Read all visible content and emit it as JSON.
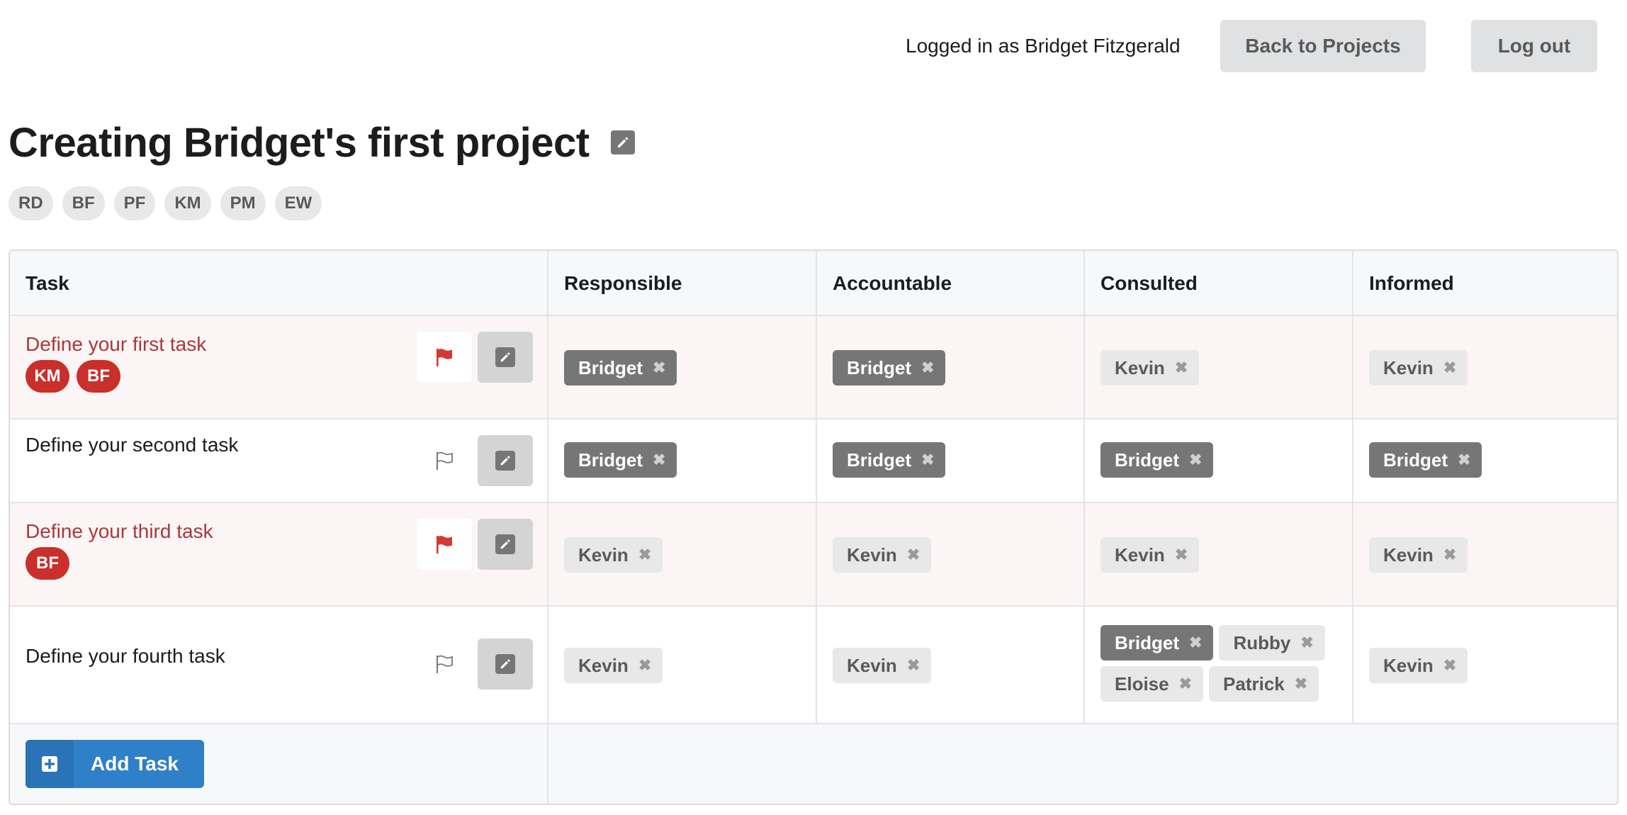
{
  "header": {
    "logged_in_text": "Logged in as Bridget Fitzgerald",
    "back_label": "Back to Projects",
    "logout_label": "Log out"
  },
  "project": {
    "title": "Creating Bridget's first project",
    "members": [
      "RD",
      "BF",
      "PF",
      "KM",
      "PM",
      "EW"
    ]
  },
  "table": {
    "columns": [
      "Task",
      "Responsible",
      "Accountable",
      "Consulted",
      "Informed"
    ],
    "rows": [
      {
        "task": "Define your first task",
        "flagged": true,
        "owners": [
          "KM",
          "BF"
        ],
        "responsible": [
          {
            "name": "Bridget",
            "style": "dark"
          }
        ],
        "accountable": [
          {
            "name": "Bridget",
            "style": "dark"
          }
        ],
        "consulted": [
          {
            "name": "Kevin",
            "style": "light"
          }
        ],
        "informed": [
          {
            "name": "Kevin",
            "style": "light"
          }
        ]
      },
      {
        "task": "Define your second task",
        "flagged": false,
        "owners": [],
        "responsible": [
          {
            "name": "Bridget",
            "style": "dark"
          }
        ],
        "accountable": [
          {
            "name": "Bridget",
            "style": "dark"
          }
        ],
        "consulted": [
          {
            "name": "Bridget",
            "style": "dark"
          }
        ],
        "informed": [
          {
            "name": "Bridget",
            "style": "dark"
          }
        ]
      },
      {
        "task": "Define your third task",
        "flagged": true,
        "owners": [
          "BF"
        ],
        "responsible": [
          {
            "name": "Kevin",
            "style": "light"
          }
        ],
        "accountable": [
          {
            "name": "Kevin",
            "style": "light"
          }
        ],
        "consulted": [
          {
            "name": "Kevin",
            "style": "light"
          }
        ],
        "informed": [
          {
            "name": "Kevin",
            "style": "light"
          }
        ]
      },
      {
        "task": "Define your fourth task",
        "flagged": false,
        "owners": [],
        "responsible": [
          {
            "name": "Kevin",
            "style": "light"
          }
        ],
        "accountable": [
          {
            "name": "Kevin",
            "style": "light"
          }
        ],
        "consulted": [
          {
            "name": "Bridget",
            "style": "dark"
          },
          {
            "name": "Rubby",
            "style": "light"
          },
          {
            "name": "Eloise",
            "style": "light"
          },
          {
            "name": "Patrick",
            "style": "light"
          }
        ],
        "informed": [
          {
            "name": "Kevin",
            "style": "light"
          }
        ]
      }
    ]
  },
  "footer": {
    "add_task_label": "Add Task"
  },
  "icons": {
    "remove": "close-icon",
    "flag": "flag-icon",
    "edit": "pencil-icon",
    "add": "plus-square-icon"
  },
  "colors": {
    "flag_red": "#d33a35",
    "owner_red": "#c9302c",
    "flagged_text": "#a8393b",
    "primary_blue": "#2f80c9",
    "dark_tag": "#767676",
    "light_tag": "#e8e8e8"
  }
}
